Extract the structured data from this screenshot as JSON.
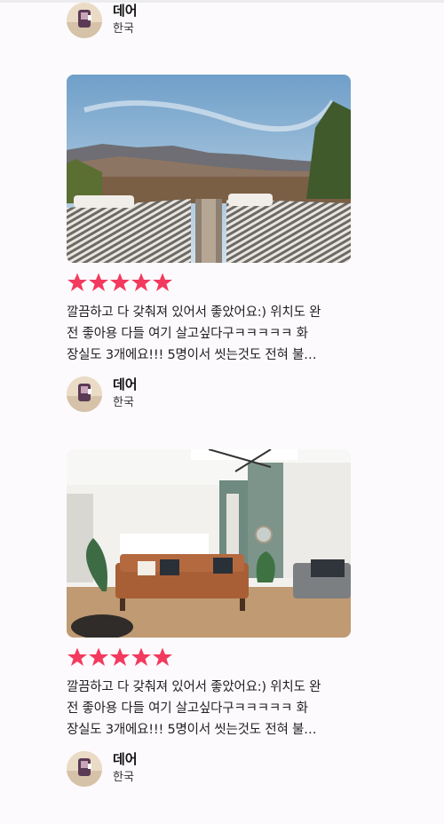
{
  "top_reviewer": {
    "name": "데어",
    "country": "한국"
  },
  "reviews": [
    {
      "rating": 5,
      "text_lines": [
        "깔끔하고 다 갖춰져 있어서 좋았어요:) 위치도 완",
        "전 좋아용 다들 여기 살고싶다구ㅋㅋㅋㅋㅋ 화",
        "장실도 3개에요!!! 5명이서 씻는것도 전혀 불…"
      ],
      "reviewer": {
        "name": "데어",
        "country": "한국"
      }
    },
    {
      "rating": 5,
      "text_lines": [
        "깔끔하고 다 갖춰져 있어서 좋았어요:) 위치도 완",
        "전 좋아용 다들 여기 살고싶다구ㅋㅋㅋㅋㅋ 화",
        "장실도 3개에요!!! 5명이서 씻는것도 전혀 불…"
      ],
      "reviewer": {
        "name": "데어",
        "country": "한국"
      }
    }
  ],
  "colors": {
    "star": "#f33a5e",
    "background": "#fdfafd"
  },
  "icons": {
    "star": "star-icon"
  }
}
